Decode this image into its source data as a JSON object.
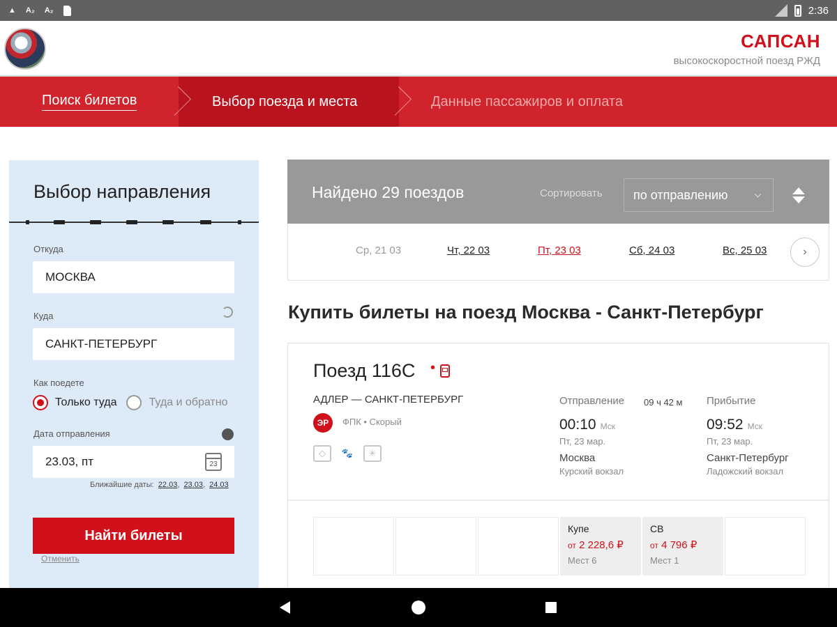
{
  "status_bar": {
    "time": "2:36"
  },
  "brand": {
    "name": "САПСАН",
    "subtitle": "высокоскоростной поезд РЖД"
  },
  "steps": [
    {
      "label": "Поиск билетов"
    },
    {
      "label": "Выбор поезда и места"
    },
    {
      "label": "Данные пассажиров и оплата"
    }
  ],
  "search_form": {
    "title": "Выбор направления",
    "from_label": "Откуда",
    "from_value": "МОСКВА",
    "to_label": "Куда",
    "to_value": "САНКТ-ПЕТЕРБУРГ",
    "trip_label": "Как поедете",
    "trip_one_way": "Только туда",
    "trip_round": "Туда и обратно",
    "date_label": "Дата отправления",
    "date_value": "23.03, пт",
    "calendar_day": "23",
    "near_dates_label": "Ближайшие даты:",
    "near_dates": [
      "22.03",
      "23.03",
      "24.03"
    ],
    "find_button": "Найти билеты",
    "cancel_link": "Отменить"
  },
  "results": {
    "found_text": "Найдено 29 поездов",
    "sort_label": "Сортировать",
    "sort_value": "по отправлению",
    "dates": [
      "Ср, 21 03",
      "Чт, 22 03",
      "Пт, 23 03",
      "Сб, 24 03",
      "Вс, 25 03"
    ],
    "next_arrow": "›"
  },
  "page_heading": "Купить билеты на поезд Москва - Санкт-Петербург",
  "train": {
    "title": "Поезд 116С",
    "dot": "•",
    "route": "АДЛЕР — САНКТ-ПЕТЕРБУРГ",
    "badge": "ЭР",
    "carrier": "ФПК • Скорый",
    "departure_label": "Отправление",
    "duration": "09 ч 42 м",
    "arrival_label": "Прибытие",
    "departure_time": "00:10",
    "departure_tz": "Мск",
    "departure_date": "Пт, 23 мар.",
    "departure_city": "Москва",
    "departure_station": "Курский вокзал",
    "arrival_time": "09:52",
    "arrival_tz": "Мск",
    "arrival_date": "Пт, 23 мар.",
    "arrival_city": "Санкт-Петербург",
    "arrival_station": "Ладожский вокзал",
    "cars": [
      {
        "type": "Купе",
        "price_prefix": "от",
        "price": "2 228,6 ₽",
        "seats": "Мест 6"
      },
      {
        "type": "СВ",
        "price_prefix": "от",
        "price": "4 796 ₽",
        "seats": "Мест 1"
      }
    ]
  }
}
